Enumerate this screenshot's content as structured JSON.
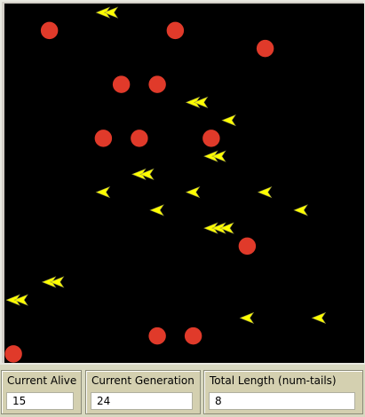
{
  "world": {
    "background": "#000000",
    "grid_size": 20,
    "food": {
      "color": "#e03a2a",
      "cells": [
        [
          2,
          1
        ],
        [
          9,
          1
        ],
        [
          14,
          2
        ],
        [
          6,
          4
        ],
        [
          8,
          4
        ],
        [
          5,
          7
        ],
        [
          7,
          7
        ],
        [
          11,
          7
        ],
        [
          13,
          13
        ],
        [
          8,
          18
        ],
        [
          10,
          18
        ],
        [
          0,
          19
        ]
      ]
    },
    "arrows": {
      "color": "#ffff00",
      "cells": [
        [
          5,
          0,
          2
        ],
        [
          10,
          5,
          2
        ],
        [
          12,
          6,
          1
        ],
        [
          11,
          8,
          2
        ],
        [
          7,
          9,
          2
        ],
        [
          5,
          10,
          1
        ],
        [
          10,
          10,
          1
        ],
        [
          14,
          10,
          1
        ],
        [
          8,
          11,
          1
        ],
        [
          16,
          11,
          1
        ],
        [
          11,
          12,
          3
        ],
        [
          2,
          15,
          2
        ],
        [
          0,
          16,
          2
        ],
        [
          13,
          17,
          1
        ],
        [
          17,
          17,
          1
        ]
      ]
    }
  },
  "monitors": [
    {
      "label": "Current Alive",
      "value": "15"
    },
    {
      "label": "Current Generation",
      "value": "24"
    },
    {
      "label": "Total Length (num-tails)",
      "value": "8"
    }
  ]
}
